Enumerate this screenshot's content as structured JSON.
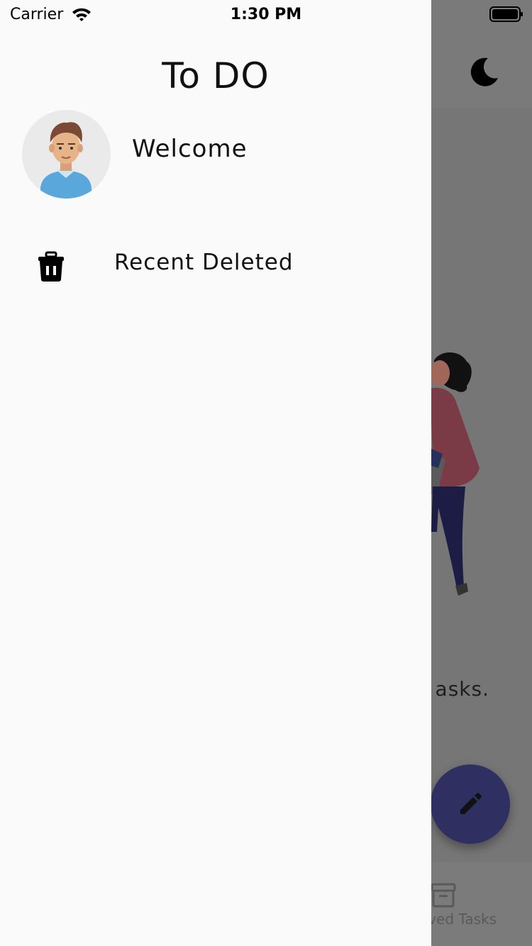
{
  "status_bar": {
    "carrier": "Carrier",
    "time": "1:30 PM"
  },
  "drawer": {
    "title": "To DO",
    "welcome": "Welcome",
    "items": [
      {
        "label": "Recent Deleted",
        "icon": "trash-icon"
      }
    ]
  },
  "background": {
    "empty_text": "asks.",
    "bottom_tab_label": "ved Tasks",
    "icons": [
      "moon-icon",
      "edit-icon",
      "archive-icon"
    ]
  },
  "colors": {
    "drawer_bg": "#fafafa",
    "scrim": "#767676",
    "fab": "#2f2f62"
  }
}
